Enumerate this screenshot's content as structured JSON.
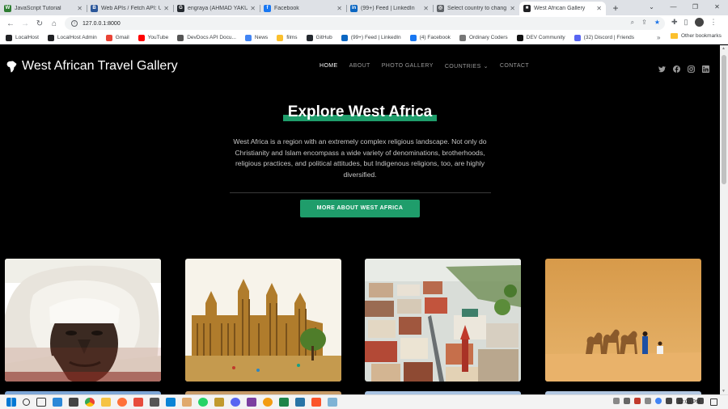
{
  "browser": {
    "tabs": [
      {
        "title": "JavaScript Tutorial",
        "color": "#2e7d32",
        "glyph": "W"
      },
      {
        "title": "Web APIs / Fetch API: U",
        "color": "#2b579a",
        "glyph": "B"
      },
      {
        "title": "engraya (AHMAD YAKU",
        "color": "#24292f",
        "glyph": "G"
      },
      {
        "title": "Facebook",
        "color": "#1877f2",
        "glyph": "f"
      },
      {
        "title": "(99+) Feed | LinkedIn",
        "color": "#0a66c2",
        "glyph": "in"
      },
      {
        "title": "Select country to chang",
        "color": "#5f6368",
        "glyph": "◎"
      },
      {
        "title": "West African Gallery",
        "color": "#202124",
        "glyph": "■",
        "active": true
      }
    ],
    "new_tab_glyph": "+",
    "url": "127.0.0.1:8000",
    "bookmarks": [
      {
        "label": "LocalHost",
        "color": "#202124"
      },
      {
        "label": "LocalHost Admin",
        "color": "#202124"
      },
      {
        "label": "Gmail",
        "color": "#ea4335"
      },
      {
        "label": "YouTube",
        "color": "#ff0000"
      },
      {
        "label": "DevDocs API Docu...",
        "color": "#555"
      },
      {
        "label": "News",
        "color": "#4285f4"
      },
      {
        "label": "films",
        "color": "#fbc02d"
      },
      {
        "label": "GitHub",
        "color": "#24292f"
      },
      {
        "label": "(99+) Feed | LinkedIn",
        "color": "#0a66c2"
      },
      {
        "label": "(4) Facebook",
        "color": "#1877f2"
      },
      {
        "label": "Ordinary Coders",
        "color": "#777"
      },
      {
        "label": "DEV Community",
        "color": "#111"
      },
      {
        "label": "(32) Discord | Friends",
        "color": "#5865f2"
      }
    ],
    "other_bookmarks": "Other bookmarks"
  },
  "site": {
    "brand": "West African Travel Gallery",
    "nav": [
      {
        "label": "HOME",
        "active": true
      },
      {
        "label": "ABOUT"
      },
      {
        "label": "PHOTO GALLERY"
      },
      {
        "label": "COUNTRIES"
      },
      {
        "label": "CONTACT"
      }
    ],
    "social_icons": [
      "twitter-icon",
      "facebook-icon",
      "instagram-icon",
      "linkedin-icon"
    ],
    "hero": {
      "title": "Explore West Africa",
      "text": "West Africa is a region with an extremely complex religious landscape. Not only do Christianity and Islam encompass a wide variety of denominations, brotherhoods, religious practices, and political attitudes, but Indigenous religions, too, are highly diversified.",
      "cta": "MORE ABOUT WEST AFRICA"
    },
    "accent": "#1f9d6b",
    "gallery": [
      "man-in-turban-photo",
      "great-mosque-photo",
      "city-rooftops-photo",
      "desert-camels-photo"
    ]
  },
  "taskbar": {
    "time": "12:03 PM"
  }
}
